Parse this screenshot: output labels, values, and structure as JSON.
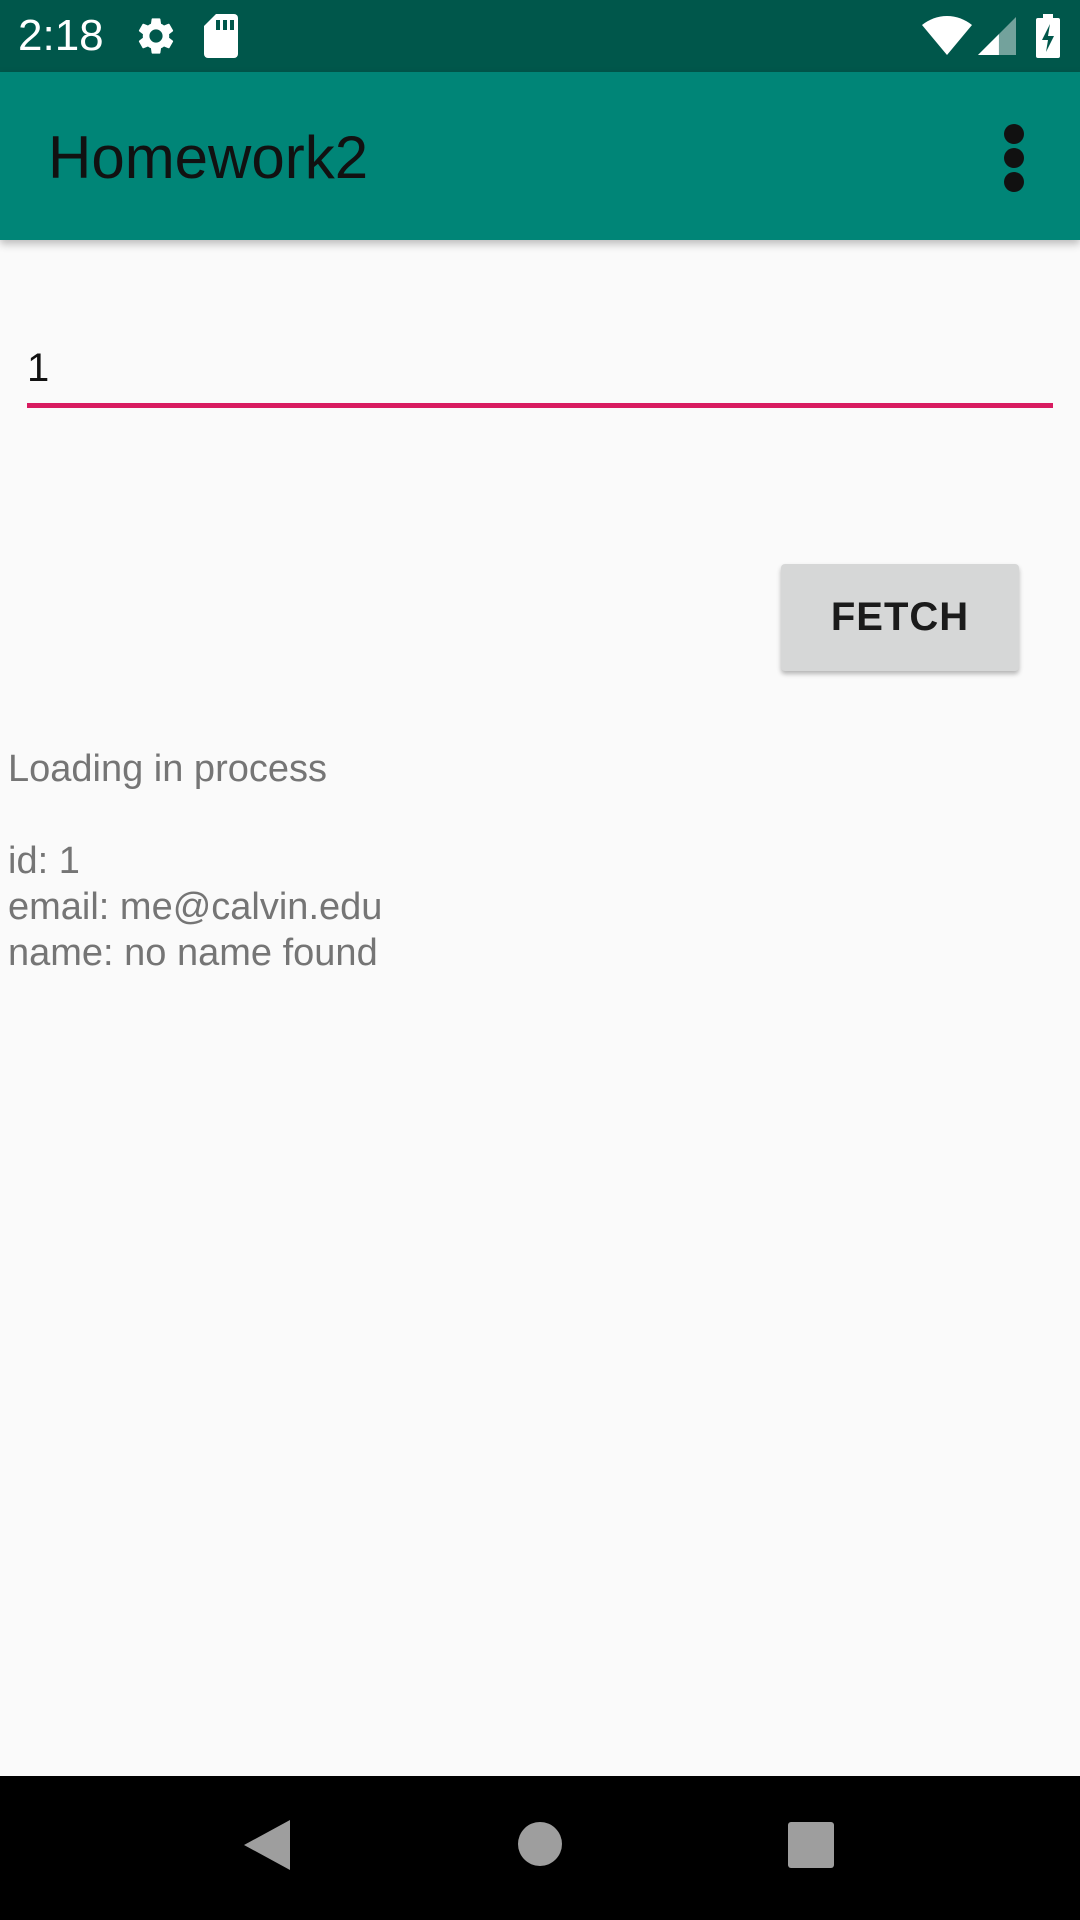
{
  "status_bar": {
    "time": "2:18",
    "icons": [
      "gear-icon",
      "sd-card-icon",
      "wifi-icon",
      "signal-icon",
      "battery-charging-icon"
    ]
  },
  "app_bar": {
    "title": "Homework2",
    "overflow_icon": "more-vert-icon"
  },
  "form": {
    "id_value": "1",
    "fetch_label": "FETCH",
    "underline_color": "#d81b60"
  },
  "result": {
    "lines": [
      "Loading in process",
      "",
      "id: 1",
      "email: me@calvin.edu",
      "name: no name found"
    ]
  },
  "nav_bar": {
    "icons": [
      "back-icon",
      "home-icon",
      "recents-icon"
    ]
  },
  "colors": {
    "status_bar": "#00574b",
    "app_bar": "#008577",
    "background": "#fafafa",
    "button": "#d6d7d7",
    "accent": "#d81b60"
  }
}
